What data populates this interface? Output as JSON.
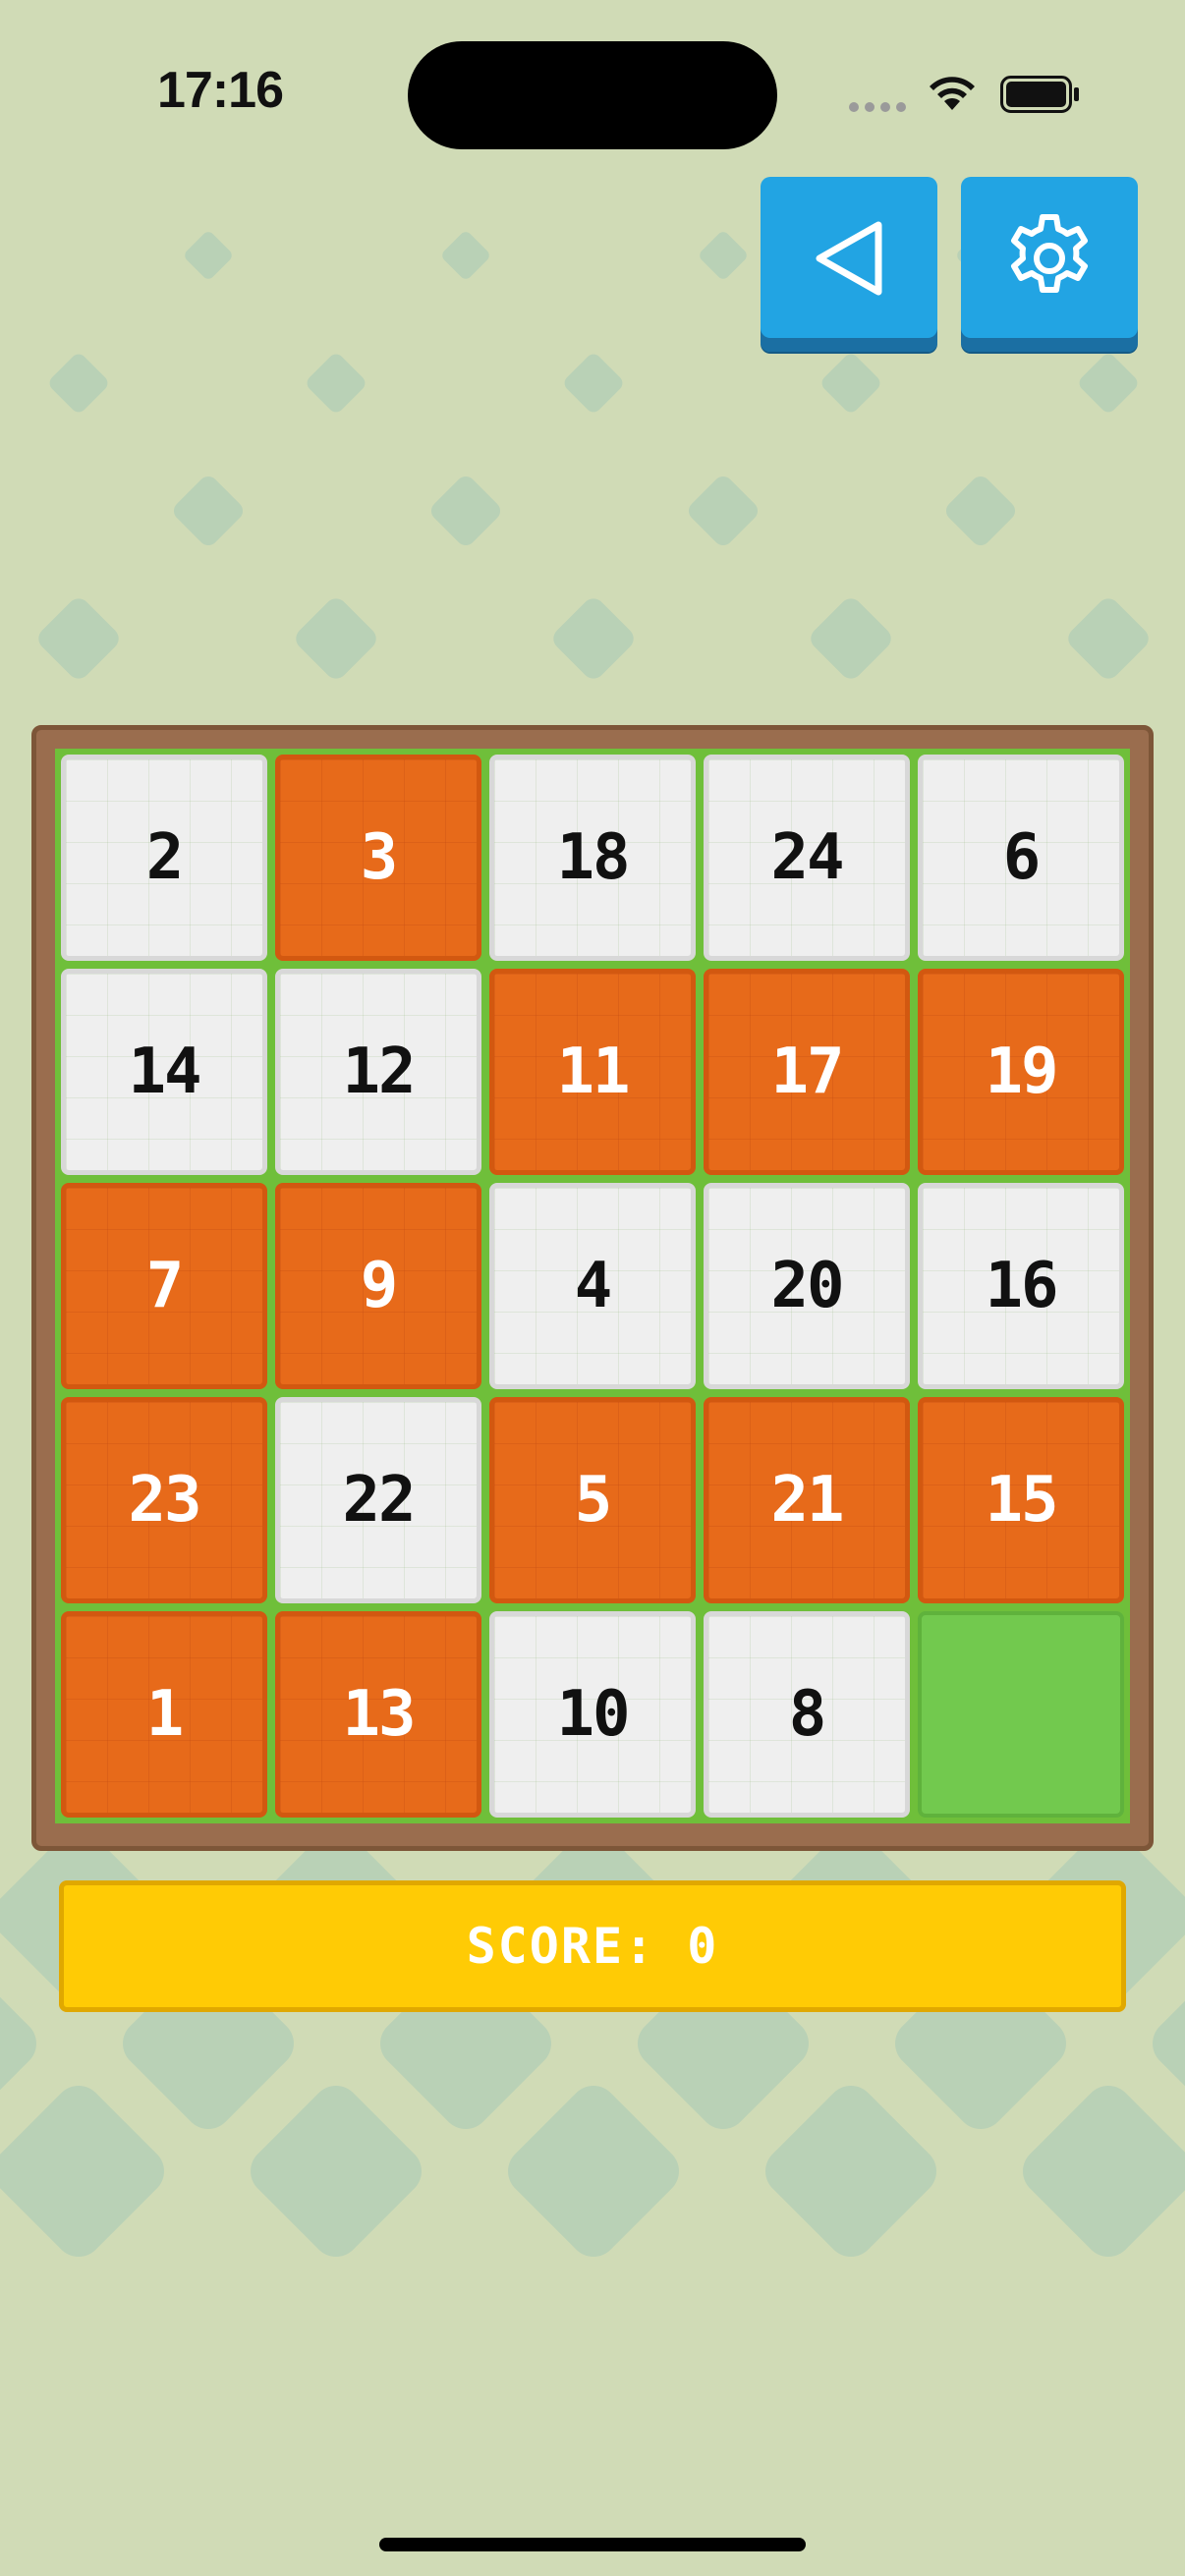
{
  "status_bar": {
    "time": "17:16"
  },
  "toolbar": {
    "back_icon": "triangle-left-icon",
    "settings_icon": "gear-icon"
  },
  "colors": {
    "background": "#d0dbb6",
    "pattern": "#a9c6b2",
    "tile_light": "#efefef",
    "tile_orange": "#e76a1a",
    "empty_slot": "#72c94e",
    "board_frame": "#9a6d4e",
    "button_blue": "#22a4e3",
    "score_yellow": "#ffcb05"
  },
  "board": {
    "rows": [
      [
        {
          "value": "2",
          "style": "light"
        },
        {
          "value": "3",
          "style": "orange"
        },
        {
          "value": "18",
          "style": "light"
        },
        {
          "value": "24",
          "style": "light"
        },
        {
          "value": "6",
          "style": "light"
        }
      ],
      [
        {
          "value": "14",
          "style": "light"
        },
        {
          "value": "12",
          "style": "light"
        },
        {
          "value": "11",
          "style": "orange"
        },
        {
          "value": "17",
          "style": "orange"
        },
        {
          "value": "19",
          "style": "orange"
        }
      ],
      [
        {
          "value": "7",
          "style": "orange"
        },
        {
          "value": "9",
          "style": "orange"
        },
        {
          "value": "4",
          "style": "light"
        },
        {
          "value": "20",
          "style": "light"
        },
        {
          "value": "16",
          "style": "light"
        }
      ],
      [
        {
          "value": "23",
          "style": "orange"
        },
        {
          "value": "22",
          "style": "light"
        },
        {
          "value": "5",
          "style": "orange"
        },
        {
          "value": "21",
          "style": "orange"
        },
        {
          "value": "15",
          "style": "orange"
        }
      ],
      [
        {
          "value": "1",
          "style": "orange"
        },
        {
          "value": "13",
          "style": "orange"
        },
        {
          "value": "10",
          "style": "light"
        },
        {
          "value": "8",
          "style": "light"
        },
        {
          "value": "",
          "style": "empty"
        }
      ]
    ]
  },
  "score": {
    "label": "SCORE: 0"
  }
}
